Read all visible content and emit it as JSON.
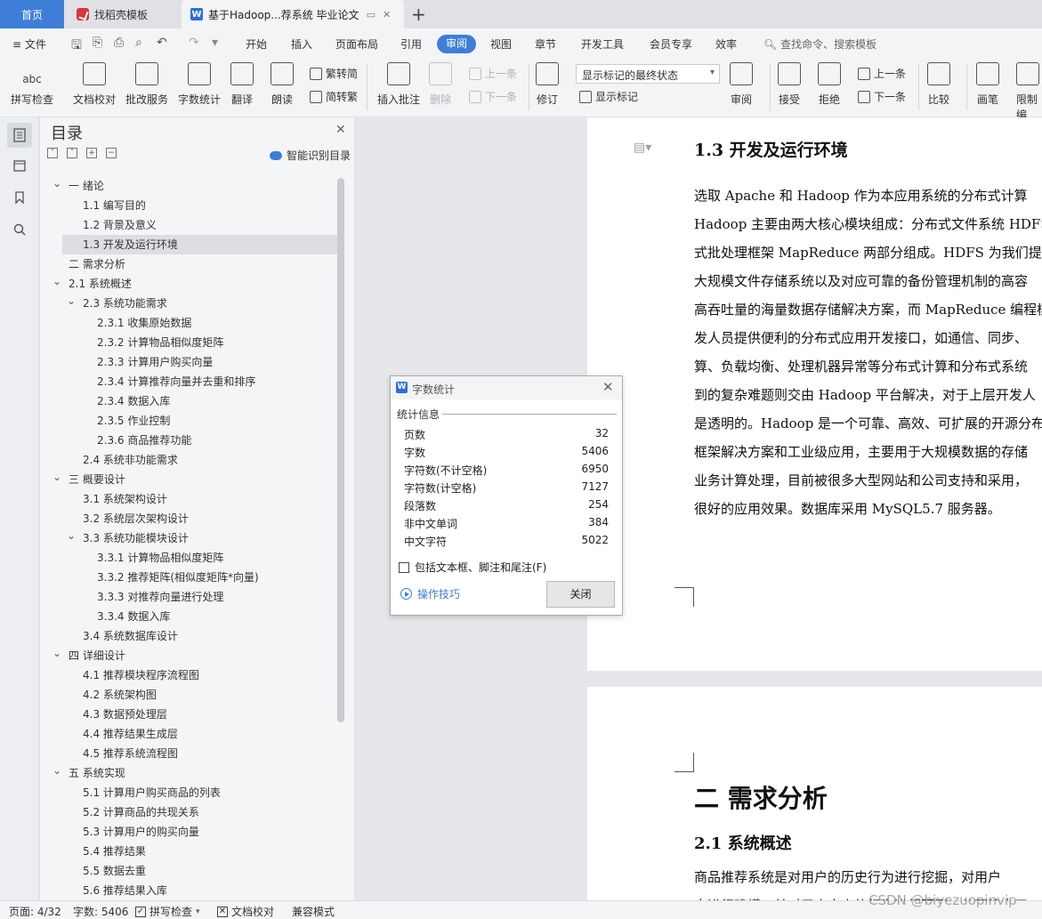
{
  "tabs": {
    "home": "首页",
    "find_template": "找稻壳模板",
    "document": "基于Hadoop...荐系统 毕业论文"
  },
  "menu": {
    "file": "文件",
    "items": [
      "开始",
      "插入",
      "页面布局",
      "引用",
      "审阅",
      "视图",
      "章节",
      "开发工具",
      "会员专享",
      "效率"
    ],
    "active": "审阅",
    "search": "查找命令、搜索模板"
  },
  "ribbon": {
    "spell_check": "拼写检查",
    "doc_proof": "文档校对",
    "batch_service": "批改服务",
    "word_count": "字数统计",
    "translate": "翻译",
    "read_aloud": "朗读",
    "to_traditional": "繁转简",
    "to_simplified": "简转繁",
    "insert_comment": "插入批注",
    "delete": "删除",
    "prev_comment": "上一条",
    "next_comment": "下一条",
    "revise": "修订",
    "markup_state": "显示标记的最终状态",
    "show_markup": "显示标记",
    "review": "审阅",
    "accept": "接受",
    "reject": "拒绝",
    "prev_change": "上一条",
    "next_change": "下一条",
    "compare": "比较",
    "pen": "画笔",
    "restrict": "限制编"
  },
  "toc": {
    "title": "目录",
    "smart": "智能识别目录",
    "items": [
      {
        "text": "一  绪论",
        "level": 1,
        "expanded": true
      },
      {
        "text": "1.1  编写目的",
        "level": 2
      },
      {
        "text": "1.2  背景及意义",
        "level": 2
      },
      {
        "text": "1.3  开发及运行环境",
        "level": 2,
        "selected": true
      },
      {
        "text": "二  需求分析",
        "level": 1
      },
      {
        "text": "2.1  系统概述",
        "level": 1,
        "expanded": true
      },
      {
        "text": "2.3  系统功能需求",
        "level": 2,
        "expanded": true
      },
      {
        "text": "2.3.1  收集原始数据",
        "level": 3
      },
      {
        "text": "2.3.2  计算物品相似度矩阵",
        "level": 3
      },
      {
        "text": "2.3.3  计算用户购买向量",
        "level": 3
      },
      {
        "text": "2.3.4  计算推荐向量并去重和排序",
        "level": 3
      },
      {
        "text": "2.3.4  数据入库",
        "level": 3
      },
      {
        "text": "2.3.5  作业控制",
        "level": 3
      },
      {
        "text": "2.3.6 商品推荐功能",
        "level": 3
      },
      {
        "text": "2.4  系统非功能需求",
        "level": 2
      },
      {
        "text": "三  概要设计",
        "level": 1,
        "expanded": true
      },
      {
        "text": "3.1 系统架构设计",
        "level": 2
      },
      {
        "text": "3.2 系统层次架构设计",
        "level": 2
      },
      {
        "text": "3.3 系统功能模块设计",
        "level": 2,
        "expanded": true
      },
      {
        "text": "3.3.1  计算物品相似度矩阵",
        "level": 3
      },
      {
        "text": "3.3.2 推荐矩阵(相似度矩阵*向量)",
        "level": 3
      },
      {
        "text": "3.3.3 对推荐向量进行处理",
        "level": 3
      },
      {
        "text": "3.3.4 数据入库",
        "level": 3
      },
      {
        "text": "3.4 系统数据库设计",
        "level": 2
      },
      {
        "text": "四  详细设计",
        "level": 1,
        "expanded": true
      },
      {
        "text": "4.1 推荐模块程序流程图",
        "level": 2
      },
      {
        "text": "4.2 系统架构图",
        "level": 2
      },
      {
        "text": "4.3 数据预处理层",
        "level": 2
      },
      {
        "text": "4.4 推荐结果生成层",
        "level": 2
      },
      {
        "text": "4.5 推荐系统流程图",
        "level": 2
      },
      {
        "text": "五  系统实现",
        "level": 1,
        "expanded": true
      },
      {
        "text": "5.1 计算用户购买商品的列表",
        "level": 2
      },
      {
        "text": "5.2 计算商品的共现关系",
        "level": 2
      },
      {
        "text": "5.3 计算用户的购买向量",
        "level": 2
      },
      {
        "text": "5.4 推荐结果",
        "level": 2
      },
      {
        "text": "5.5 数据去重",
        "level": 2
      },
      {
        "text": "5.6 推荐结果入库",
        "level": 2
      }
    ]
  },
  "document": {
    "heading_1_3": "1.3  开发及运行环境",
    "para1": [
      "      选取 Apache 和 Hadoop 作为本应用系统的分布式计算",
      "Hadoop 主要由两大核心模块组成：分布式文件系统 HDFS",
      "式批处理框架 MapReduce 两部分组成。HDFS 为我们提供",
      "大规模文件存储系统以及对应可靠的备份管理机制的高容",
      "高吞吐量的海量数据存储解决方案，而 MapReduce 编程模",
      "发人员提供便利的分布式应用开发接口，如通信、同步、",
      "算、负载均衡、处理机器异常等分布式计算和分布式系统",
      "到的复杂难题则交由 Hadoop 平台解决，对于上层开发人",
      "是透明的。Hadoop 是一个可靠、高效、可扩展的开源分布",
      "框架解决方案和工业级应用，主要用于大规模数据的存储",
      "业务计算处理，目前被很多大型网站和公司支持和采用，",
      "很好的应用效果。数据库采用 MySQL5.7 服务器。"
    ],
    "heading_2": "二  需求分析",
    "heading_2_1": "2.1  系统概述",
    "para2": [
      "      商品推荐系统是对用户的历史行为进行挖掘，对用户",
      "息进行建模，并对用户未来的行为进行预测，从而建立用"
    ]
  },
  "dialog": {
    "title": "字数统计",
    "section": "统计信息",
    "stats": [
      {
        "label": "页数",
        "value": "32"
      },
      {
        "label": "字数",
        "value": "5406"
      },
      {
        "label": "字符数(不计空格)",
        "value": "6950"
      },
      {
        "label": "字符数(计空格)",
        "value": "7127"
      },
      {
        "label": "段落数",
        "value": "254"
      },
      {
        "label": "非中文单词",
        "value": "384"
      },
      {
        "label": "中文字符",
        "value": "5022"
      }
    ],
    "checkbox": "包括文本框、脚注和尾注(F)",
    "tips": "操作技巧",
    "close": "关闭"
  },
  "statusbar": {
    "page": "页面: 4/32",
    "words": "字数: 5406",
    "spell": "拼写检查",
    "proof": "文档校对",
    "compat": "兼容模式"
  },
  "watermark": "CSDN @biyezuopinvip"
}
